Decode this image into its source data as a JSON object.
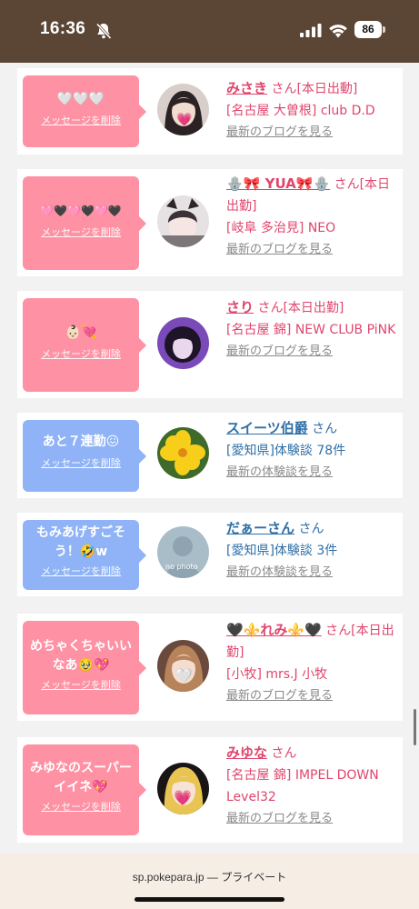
{
  "status": {
    "time": "16:36",
    "battery": "86"
  },
  "colors": {
    "pink_bubble": "#fe91a3",
    "blue_bubble": "#8fb3f6",
    "pink_text": "#e0466d",
    "blue_text": "#2f6fa6"
  },
  "cards": [
    {
      "message": "🤍🤍🤍",
      "delete": "メッセージを削除",
      "name": "みさき",
      "san": "さん[本日出動]",
      "area": "[名古屋 大曽根] club D.D",
      "link": "最新のブログを見る"
    },
    {
      "message": "🩷🖤🩷🖤🩷🖤",
      "delete": "メッセージを削除",
      "name": "🪬🎀 YUA🎀🪬",
      "san": "さん[本日出勤]",
      "area": "[岐阜 多治見] NEO",
      "link": "最新のブログを見る"
    },
    {
      "message": "👶🏻💘",
      "delete": "メッセージを削除",
      "name": "さり",
      "san": "さん[本日出勤]",
      "area": "[名古屋 錦] NEW CLUB PiNK",
      "link": "最新のブログを見る"
    },
    {
      "message": "あと７連勤😖",
      "delete": "メッセージを削除",
      "name": "スイーツ伯爵",
      "san": "さん",
      "area": "[愛知県]体験談 78件",
      "link": "最新の体験談を見る"
    },
    {
      "message": "もみあげすごそう！🤣w",
      "delete": "メッセージを削除",
      "name": "だぁーさん",
      "san": "さん",
      "area": "[愛知県]体験談 3件",
      "link": "最新の体験談を見る",
      "avatar_text": "no photo"
    },
    {
      "message": "めちゃくちゃいいなあ🥹💖",
      "delete": "メッセージを削除",
      "name": "🖤⚜️れみ⚜️🖤",
      "san": "さん[本日出勤]",
      "area": "[小牧] mrs.J 小牧",
      "link": "最新のブログを見る"
    },
    {
      "message": "みゆなのスーパーイイネ💖",
      "delete": "メッセージを削除",
      "name": "みゆな",
      "san": "さん",
      "area": "[名古屋 錦] IMPEL DOWN Level32",
      "link": "最新のブログを見る"
    }
  ],
  "footer": {
    "domain": "sp.pokepara.jp",
    "suffix": "— プライベート"
  }
}
